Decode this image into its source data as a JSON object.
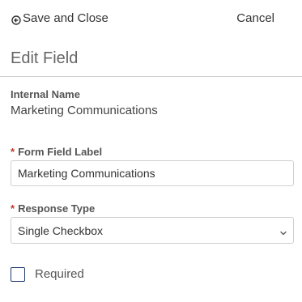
{
  "toolbar": {
    "save_close_label": "Save and Close",
    "save_close_icon": "circle-arrow-left-icon",
    "cancel_label": "Cancel"
  },
  "header": {
    "title": "Edit Field"
  },
  "fields": {
    "internal_name": {
      "label": "Internal Name",
      "value": "Marketing Communications"
    },
    "form_field_label": {
      "required_mark": "*",
      "label": "Form Field Label",
      "value": "Marketing Communications"
    },
    "response_type": {
      "required_mark": "*",
      "label": "Response Type",
      "selected": "Single Checkbox",
      "icon": "chevron-down-icon"
    },
    "required": {
      "label": "Required",
      "checked": false
    }
  },
  "colors": {
    "required_mark": "#c0392b",
    "checkbox_border": "#1f3a6e",
    "divider": "#cfcfcf"
  }
}
